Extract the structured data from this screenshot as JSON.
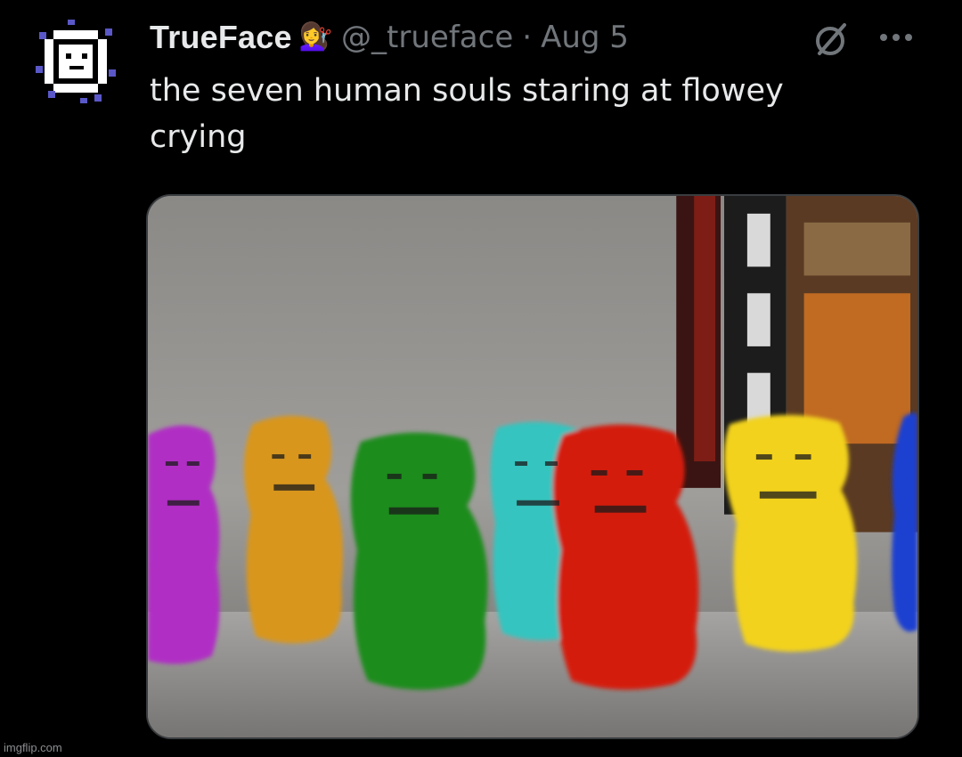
{
  "tweet": {
    "display_name": "TrueFace",
    "badge_emoji": "💇‍♀️",
    "handle": "@_trueface",
    "separator": "·",
    "date": "Aug 5",
    "text_line1": "the seven human souls staring at flowey",
    "text_line2": "crying"
  },
  "icons": {
    "avatar": "pixel-smiley-avatar",
    "grok": "grok-icon",
    "more": "more-dots-icon"
  },
  "media": {
    "description_colors": [
      "#b02fc4",
      "#d8961e",
      "#1f8c1c",
      "#35c4bf",
      "#d41d10",
      "#f2d21b",
      "#1b3fd0"
    ]
  },
  "watermark": {
    "text": "imgflip.com"
  }
}
